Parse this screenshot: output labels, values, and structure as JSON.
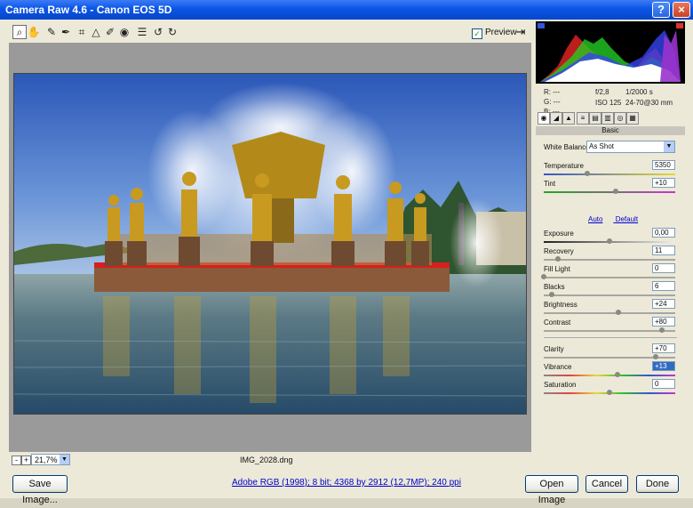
{
  "window": {
    "title": "Camera Raw 4.6  -  Canon EOS 5D",
    "help": "?",
    "close": "×"
  },
  "toolbar": {
    "tools": [
      "zoom-icon",
      "hand-icon",
      "white-balance-icon",
      "color-sampler-icon",
      "crop-icon",
      "straighten-icon",
      "retouch-icon",
      "red-eye-icon",
      "preferences-icon",
      "rotate-left-icon",
      "rotate-right-icon"
    ],
    "preview_label": "Preview",
    "preview_checked": "✓"
  },
  "canvas": {
    "zoom": "21,7%",
    "zoom_out": "-",
    "zoom_in": "+",
    "filename": "IMG_2028.dng"
  },
  "info": {
    "r": "R:   ---",
    "g": "G:   ---",
    "b": "B:   ---",
    "aperture": "f/2,8",
    "shutter": "1/2000 s",
    "iso": "ISO 125",
    "lens": "24-70@30 mm"
  },
  "panel": {
    "section": "Basic",
    "white_balance_label": "White Balance:",
    "white_balance_value": "As Shot",
    "auto": "Auto",
    "default": "Default",
    "sliders": [
      {
        "label": "Temperature",
        "value": "5350",
        "pos": 0.33
      },
      {
        "label": "Tint",
        "value": "+10",
        "pos": 0.55
      },
      {
        "label": "Exposure",
        "value": "0,00",
        "pos": 0.5
      },
      {
        "label": "Recovery",
        "value": "11",
        "pos": 0.11
      },
      {
        "label": "Fill Light",
        "value": "0",
        "pos": 0.0
      },
      {
        "label": "Blacks",
        "value": "6",
        "pos": 0.06
      },
      {
        "label": "Brightness",
        "value": "+24",
        "pos": 0.57
      },
      {
        "label": "Contrast",
        "value": "+80",
        "pos": 0.9
      },
      {
        "label": "Clarity",
        "value": "+70",
        "pos": 0.85
      },
      {
        "label": "Vibrance",
        "value": "+13",
        "pos": 0.56
      },
      {
        "label": "Saturation",
        "value": "0",
        "pos": 0.5
      }
    ]
  },
  "footer": {
    "save": "Save Image...",
    "workflow": "Adobe RGB (1998); 8 bit; 4368 by 2912 (12,7MP); 240 ppi",
    "open": "Open Image",
    "cancel": "Cancel",
    "done": "Done"
  }
}
